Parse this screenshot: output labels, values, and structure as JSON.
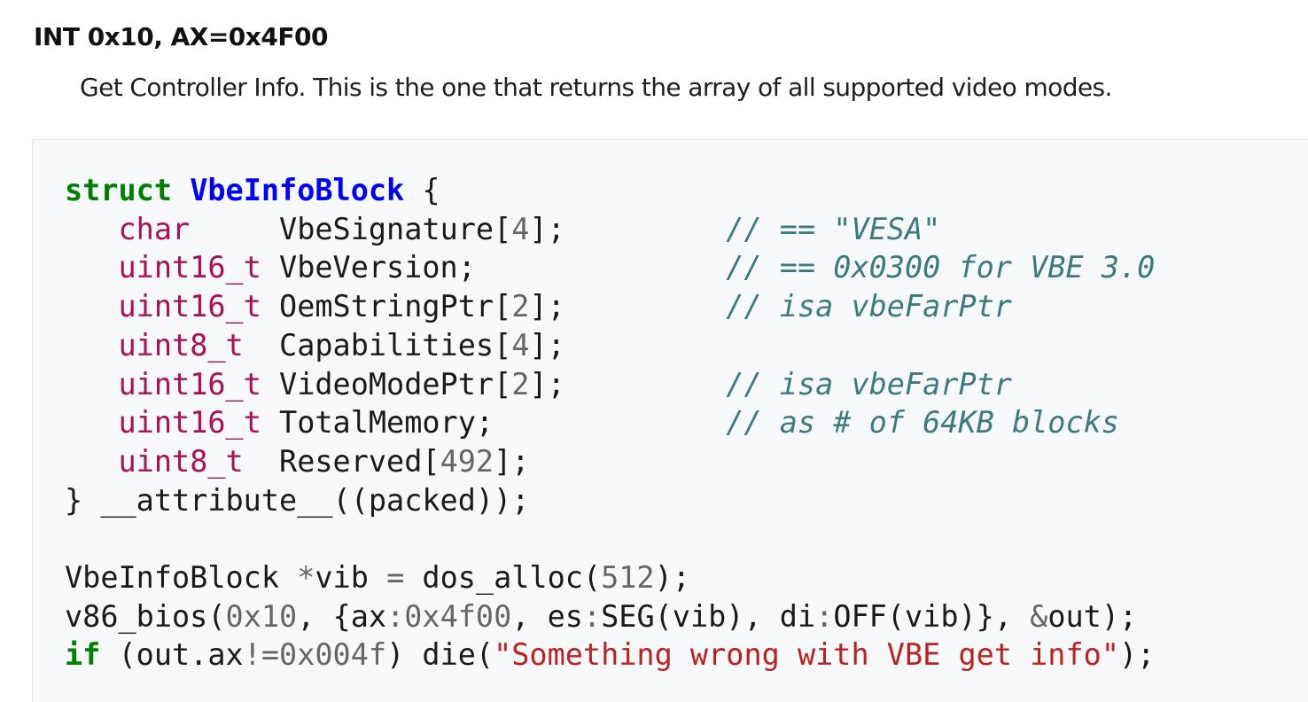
{
  "entry": {
    "term": "INT 0x10, AX=0x4F00",
    "description": "Get Controller Info. This is the one that returns the array of all supported video modes."
  },
  "code": {
    "lines": [
      [
        [
          "kw",
          "struct"
        ],
        [
          "",
          " "
        ],
        [
          "ty",
          "VbeInfoBlock"
        ],
        [
          "",
          " {"
        ]
      ],
      [
        [
          "",
          "   "
        ],
        [
          "tp",
          "char"
        ],
        [
          "",
          "     VbeSignature["
        ],
        [
          "num",
          "4"
        ],
        [
          "",
          "];         "
        ],
        [
          "cm",
          "// == \"VESA\""
        ]
      ],
      [
        [
          "",
          "   "
        ],
        [
          "tp",
          "uint16_t"
        ],
        [
          "",
          " VbeVersion;              "
        ],
        [
          "cm",
          "// == 0x0300 for VBE 3.0"
        ]
      ],
      [
        [
          "",
          "   "
        ],
        [
          "tp",
          "uint16_t"
        ],
        [
          "",
          " OemStringPtr["
        ],
        [
          "num",
          "2"
        ],
        [
          "",
          "];         "
        ],
        [
          "cm",
          "// isa vbeFarPtr"
        ]
      ],
      [
        [
          "",
          "   "
        ],
        [
          "tp",
          "uint8_t"
        ],
        [
          "",
          "  Capabilities["
        ],
        [
          "num",
          "4"
        ],
        [
          "",
          "];"
        ]
      ],
      [
        [
          "",
          "   "
        ],
        [
          "tp",
          "uint16_t"
        ],
        [
          "",
          " VideoModePtr["
        ],
        [
          "num",
          "2"
        ],
        [
          "",
          "];         "
        ],
        [
          "cm",
          "// isa vbeFarPtr"
        ]
      ],
      [
        [
          "",
          "   "
        ],
        [
          "tp",
          "uint16_t"
        ],
        [
          "",
          " TotalMemory;             "
        ],
        [
          "cm",
          "// as # of 64KB blocks"
        ]
      ],
      [
        [
          "",
          "   "
        ],
        [
          "tp",
          "uint8_t"
        ],
        [
          "",
          "  Reserved["
        ],
        [
          "num",
          "492"
        ],
        [
          "",
          "];"
        ]
      ],
      [
        [
          "",
          "} __attribute__((packed));"
        ]
      ],
      [
        [
          "",
          ""
        ]
      ],
      [
        [
          "",
          "VbeInfoBlock "
        ],
        [
          "op",
          "*"
        ],
        [
          "",
          "vib "
        ],
        [
          "op",
          "="
        ],
        [
          "",
          " dos_alloc("
        ],
        [
          "num",
          "512"
        ],
        [
          "",
          ");"
        ]
      ],
      [
        [
          "",
          "v86_bios("
        ],
        [
          "num",
          "0x10"
        ],
        [
          "",
          ", {ax"
        ],
        [
          "op",
          ":"
        ],
        [
          "num",
          "0x4f00"
        ],
        [
          "",
          ", es"
        ],
        [
          "op",
          ":"
        ],
        [
          "",
          "SEG(vib), di"
        ],
        [
          "op",
          ":"
        ],
        [
          "",
          "OFF(vib)}, "
        ],
        [
          "op",
          "&"
        ],
        [
          "",
          "out);"
        ]
      ],
      [
        [
          "kw",
          "if"
        ],
        [
          "",
          " (out.ax"
        ],
        [
          "op",
          "!="
        ],
        [
          "num",
          "0x004f"
        ],
        [
          "",
          ") die("
        ],
        [
          "str",
          "\"Something wrong with VBE get info\""
        ],
        [
          "",
          ");"
        ]
      ]
    ]
  }
}
